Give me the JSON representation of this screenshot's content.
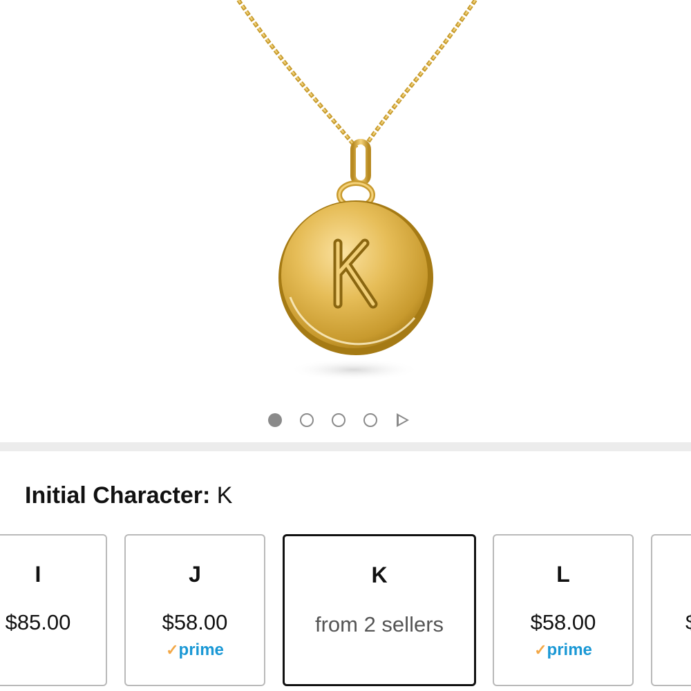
{
  "gallery": {
    "pendant_letter": "K",
    "image_count": 4,
    "active_index": 0,
    "colors": {
      "gold": "#e2b748",
      "gold_dark": "#b08519",
      "dot": "#8a8a8a"
    }
  },
  "variation": {
    "label": "Initial Character:",
    "selected_value": "K"
  },
  "swatches": [
    {
      "letter": "I",
      "price": "$85.00",
      "prime": false
    },
    {
      "letter": "J",
      "price": "$58.00",
      "prime": true,
      "prime_label": "prime"
    },
    {
      "letter": "K",
      "note": "from 2 sellers",
      "selected": true
    },
    {
      "letter": "L",
      "price": "$58.00",
      "prime": true,
      "prime_label": "prime"
    },
    {
      "letter": "",
      "price": "$",
      "prime": false
    }
  ],
  "icons": {
    "prime_check": "✓",
    "next": "play-triangle-icon"
  }
}
